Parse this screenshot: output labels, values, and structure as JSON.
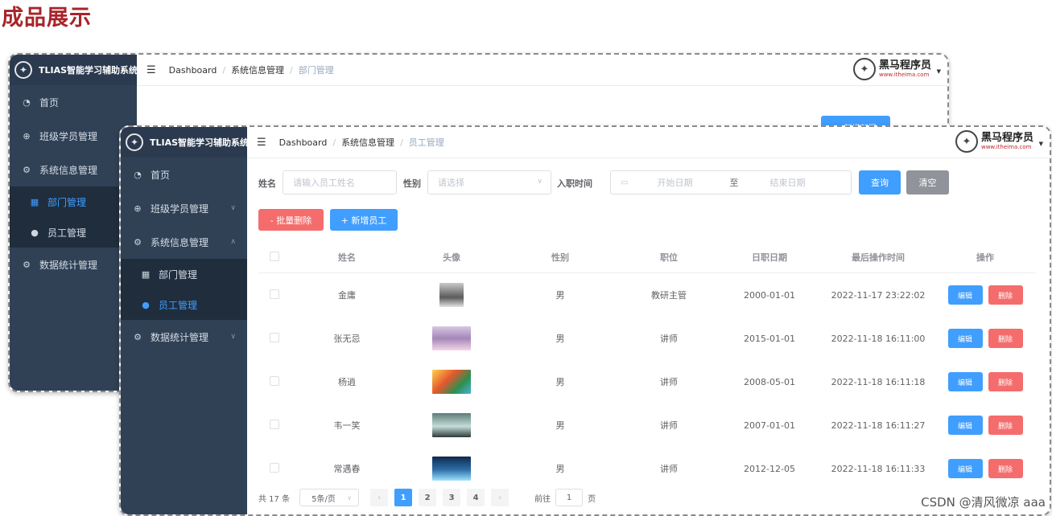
{
  "page_title": "成品展示",
  "watermark": "CSDN @清风微凉 aaa",
  "app": {
    "name": "TLIAS智能学习辅助系统",
    "brand_name": "黑马程序员",
    "brand_url": "www.itheima.com"
  },
  "back_window": {
    "breadcrumb": [
      "Dashboard",
      "系统信息管理",
      "部门管理"
    ],
    "menu": [
      {
        "label": "首页",
        "icon": "dashboard-icon"
      },
      {
        "label": "班级学员管理",
        "icon": "plus-circle-icon"
      },
      {
        "label": "系统信息管理",
        "icon": "gear-icon"
      },
      {
        "label": "部门管理",
        "icon": "grid-icon",
        "sub": true,
        "active": true
      },
      {
        "label": "员工管理",
        "icon": "user-icon",
        "sub": true
      },
      {
        "label": "数据统计管理",
        "icon": "gear-icon"
      }
    ],
    "add_button": "+ 新增部门"
  },
  "front_window": {
    "breadcrumb": [
      "Dashboard",
      "系统信息管理",
      "员工管理"
    ],
    "menu": [
      {
        "label": "首页",
        "icon": "dashboard-icon"
      },
      {
        "label": "班级学员管理",
        "icon": "plus-circle-icon",
        "chevron": "down"
      },
      {
        "label": "系统信息管理",
        "icon": "gear-icon",
        "chevron": "up"
      },
      {
        "label": "部门管理",
        "icon": "grid-icon",
        "sub": true
      },
      {
        "label": "员工管理",
        "icon": "user-icon",
        "sub": true,
        "active": true
      },
      {
        "label": "数据统计管理",
        "icon": "gear-icon",
        "chevron": "down"
      }
    ],
    "search": {
      "name_label": "姓名",
      "name_placeholder": "请输入员工姓名",
      "gender_label": "性别",
      "gender_placeholder": "请选择",
      "date_label": "入职时间",
      "start_placeholder": "开始日期",
      "range_separator": "至",
      "end_placeholder": "结束日期",
      "query_button": "查询",
      "clear_button": "清空"
    },
    "actions": {
      "batch_delete": "- 批量删除",
      "add_employee": "+ 新增员工"
    },
    "table": {
      "headers": [
        "姓名",
        "头像",
        "性别",
        "职位",
        "日职日期",
        "最后操作时间",
        "操作"
      ],
      "edit_label": "编辑",
      "delete_label": "删除",
      "rows": [
        {
          "name": "金庸",
          "gender": "男",
          "job": "教研主管",
          "entry": "2000-01-01",
          "updated": "2022-11-17 23:22:02"
        },
        {
          "name": "张无忌",
          "gender": "男",
          "job": "讲师",
          "entry": "2015-01-01",
          "updated": "2022-11-18 16:11:00"
        },
        {
          "name": "杨逍",
          "gender": "男",
          "job": "讲师",
          "entry": "2008-05-01",
          "updated": "2022-11-18 16:11:18"
        },
        {
          "name": "韦一笑",
          "gender": "男",
          "job": "讲师",
          "entry": "2007-01-01",
          "updated": "2022-11-18 16:11:27"
        },
        {
          "name": "常遇春",
          "gender": "男",
          "job": "讲师",
          "entry": "2012-12-05",
          "updated": "2022-11-18 16:11:33"
        }
      ]
    },
    "pagination": {
      "total": "共 17 条",
      "page_size": "5条/页",
      "pages": [
        "1",
        "2",
        "3",
        "4"
      ],
      "current_page": "1",
      "goto_label": "前往",
      "goto_value": "1",
      "page_suffix": "页"
    }
  }
}
